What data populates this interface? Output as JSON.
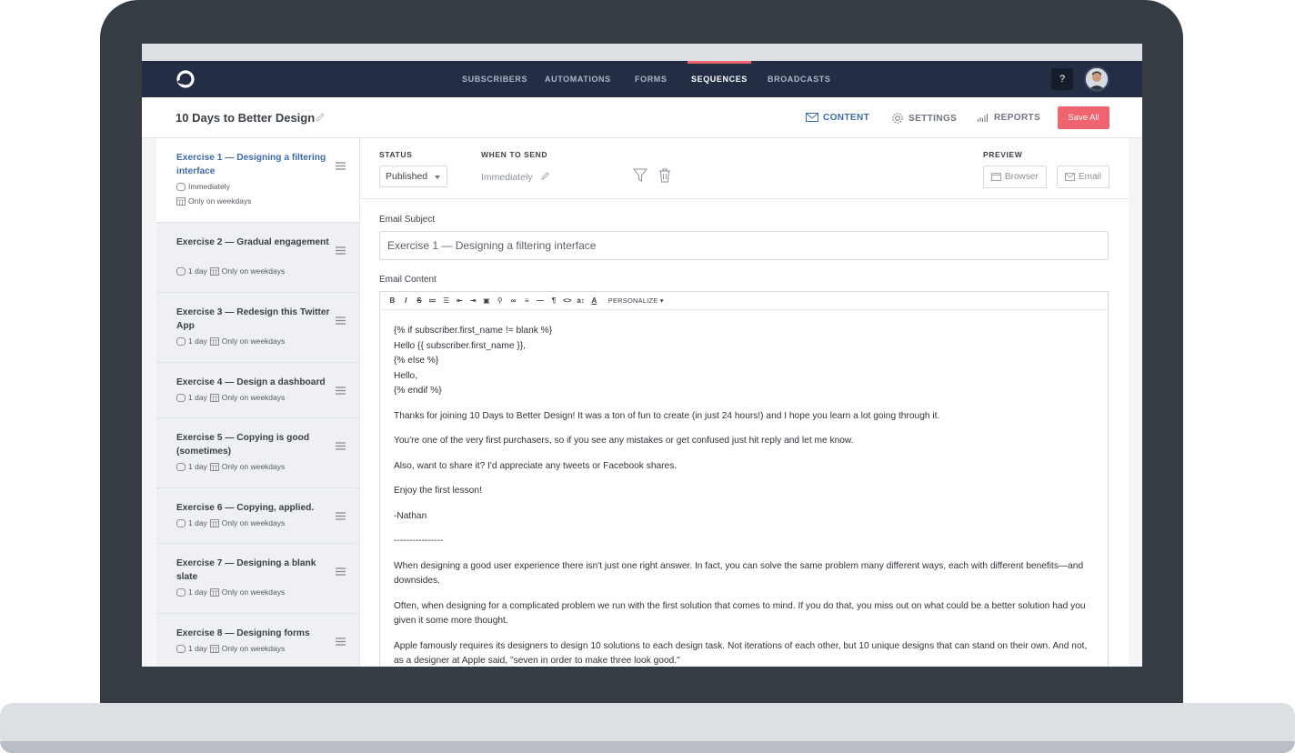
{
  "nav": {
    "links": [
      {
        "label": "SUBSCRIBERS"
      },
      {
        "label": "AUTOMATIONS"
      },
      {
        "label": "FORMS"
      },
      {
        "label": "SEQUENCES"
      },
      {
        "label": "BROADCASTS"
      }
    ],
    "active": "SEQUENCES",
    "help_label": "?"
  },
  "header": {
    "title": "10 Days to Better Design",
    "tabs": [
      {
        "label": "CONTENT",
        "icon": "envelope-icon"
      },
      {
        "label": "SETTINGS",
        "icon": "gear-icon"
      },
      {
        "label": "REPORTS",
        "icon": "bar-chart-icon"
      }
    ],
    "save_label": "Save All"
  },
  "sidebar": {
    "items": [
      {
        "title": "Exercise 1 — Designing a filtering interface",
        "timing": "Immediately",
        "schedule": "Only on weekdays"
      },
      {
        "title": "Exercise 2 — Gradual engagement",
        "timing": "1 day",
        "schedule": "Only on weekdays"
      },
      {
        "title": "Exercise 3 — Redesign this Twitter App",
        "timing": "1 day",
        "schedule": "Only on weekdays"
      },
      {
        "title": "Exercise 4 — Design a dashboard",
        "timing": "1 day",
        "schedule": "Only on weekdays"
      },
      {
        "title": "Exercise 5 — Copying is good (sometimes)",
        "timing": "1 day",
        "schedule": "Only on weekdays"
      },
      {
        "title": "Exercise 6 — Copying, applied.",
        "timing": "1 day",
        "schedule": "Only on weekdays"
      },
      {
        "title": "Exercise 7 — Designing a blank slate",
        "timing": "1 day",
        "schedule": "Only on weekdays"
      },
      {
        "title": "Exercise 8 — Designing forms",
        "timing": "1 day",
        "schedule": "Only on weekdays"
      }
    ]
  },
  "settings": {
    "status_label": "STATUS",
    "status_value": "Published",
    "when_label": "WHEN TO SEND",
    "when_value": "Immediately",
    "preview_label": "PREVIEW",
    "preview_browser": "Browser",
    "preview_email": "Email"
  },
  "email": {
    "subject_label": "Email Subject",
    "subject_value": "Exercise 1 — Designing a filtering interface",
    "content_label": "Email Content",
    "toolbar": [
      "B",
      "I",
      "S",
      "≔",
      "☰",
      "⇤",
      "⇥",
      "▣",
      "⚲",
      "∞",
      "≡",
      "—",
      "¶",
      "<>",
      "a↕",
      "A"
    ],
    "personalize_label": "PERSONALIZE ▾",
    "liquid_lines": [
      "{% if subscriber.first_name != blank %}",
      "Hello {{ subscriber.first_name }},",
      "{% else %}",
      "Hello,",
      "{% endif %}"
    ],
    "paragraphs": [
      "Thanks for joining 10 Days to Better Design! It was a ton of fun to create (in just 24 hours!) and I hope you learn a lot going through it.",
      "You're one of the very first purchasers, so if you see any mistakes or get confused just hit reply and let me know.",
      "Also, want to share it? I'd appreciate any tweets or Facebook shares.",
      "Enjoy the first lesson!",
      "-Nathan",
      "----------------",
      "When designing a good user experience there isn't just one right answer. In fact, you can solve the same problem many different ways, each with different benefits—and downsides.",
      "Often, when designing for a complicated problem we run with the first solution that comes to mind. If you do that, you miss out on what could be a better solution had you given it some more thought.",
      "Apple famously requires its designers to design 10 solutions to each design task. Not iterations of each other, but 10 unique designs that can stand on their own. And not, as a designer at Apple said, \"seven in order to make three look good.\""
    ]
  },
  "colors": {
    "nav_bg": "#232e45",
    "accent_red": "#f06470",
    "accent_blue": "#3f6aa8"
  }
}
